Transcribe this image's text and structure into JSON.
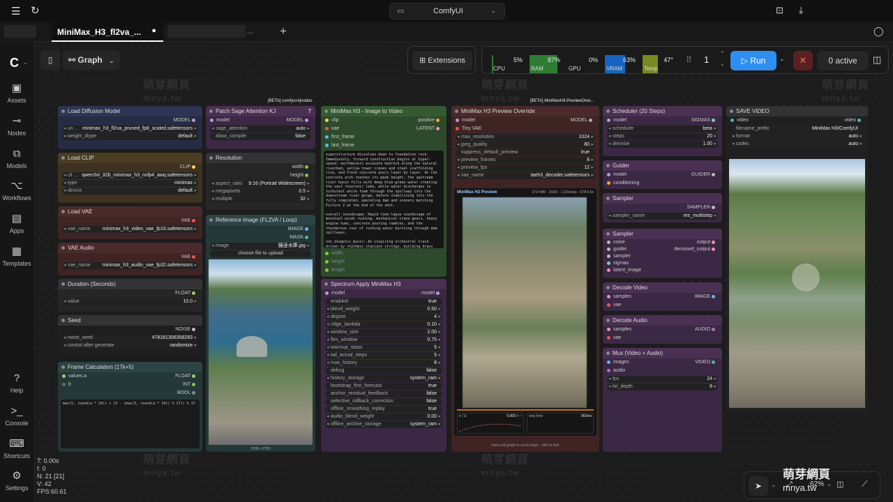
{
  "app": {
    "title": "ComfyUI"
  },
  "tab": {
    "name": "MiniMax_H3_fl2va_..."
  },
  "sidebar": {
    "items": [
      {
        "label": "Assets"
      },
      {
        "label": "Nodes"
      },
      {
        "label": "Models"
      },
      {
        "label": "Workflows"
      },
      {
        "label": "Apps"
      },
      {
        "label": "Templates"
      }
    ],
    "bottom": [
      {
        "label": "Help"
      },
      {
        "label": "Console"
      },
      {
        "label": "Shortcuts"
      },
      {
        "label": "Settings"
      }
    ]
  },
  "toolbar": {
    "graph_label": "Graph",
    "extensions_label": "Extensions",
    "run_label": "Run",
    "queue_count": "1",
    "active_label": "0 active"
  },
  "monitor": {
    "cpu": {
      "label": "CPU",
      "value": "5%",
      "level": 0.05,
      "color": "#2e7d32"
    },
    "ram": {
      "label": "RAM",
      "value": "87%",
      "level": 0.87,
      "color": "#2e7d32"
    },
    "gpu": {
      "label": "GPU",
      "value": "0%",
      "level": 0.0,
      "color": "#2e7d32"
    },
    "vram": {
      "label": "VRAM",
      "value": "63%",
      "level": 0.63,
      "color": "#1565c0"
    },
    "temp": {
      "label": "Temp",
      "value": "47°",
      "level": 0.47,
      "color": "#7a8a1e"
    }
  },
  "badges": {
    "kjnodes": "[BETA] comfyui-kjnodes",
    "preview": "[BETA] MiniMaxH3-PreviewOver..."
  },
  "nodes": {
    "load_diffusion": {
      "title": "Load Diffusion Model",
      "out": "MODEL",
      "unet_label": "un ...",
      "unet_value": "minimax_h3_fl2va_pruned_fp8_scaled.safetensors",
      "wd_label": "weight_dtype",
      "wd_value": "default"
    },
    "patch_sage": {
      "title": "Patch Sage Attention KJ",
      "in": "model",
      "out": "MODEL",
      "sage_label": "sage_attention",
      "sage_value": "auto",
      "compile_label": "allow_compile",
      "compile_value": "false",
      "badge": "?"
    },
    "load_clip": {
      "title": "Load CLIP",
      "out": "CLIP",
      "clip_label": "cli ...",
      "clip_value": "qwen3vl_32b_minimax_h3_nvfp4_awq.safetensors",
      "type_label": "type",
      "type_value": "minimax",
      "device_label": "device",
      "device_value": "default"
    },
    "resolution": {
      "title": "Resolution",
      "out_w": "width",
      "out_h": "height",
      "ar_label": "aspect_ratio",
      "ar_value": "9:16 (Portrait Widescreen)",
      "mp_label": "megapixels",
      "mp_value": "0.5",
      "mult_label": "multiple",
      "mult_value": "32"
    },
    "load_vae": {
      "title": "Load VAE",
      "out": "VAE",
      "vae_label": "vae_name",
      "vae_value": "minimax_h3_video_vae_fp16.safetensors"
    },
    "ref_image": {
      "title": "Reference Image (FL2VA / Loop)",
      "out_img": "IMAGE",
      "out_mask": "MASK",
      "img_label": "image",
      "img_value": "鐘逹水庫.jpg",
      "upload": "choose file to upload",
      "size": "1536 × 2752"
    },
    "vae_audio": {
      "title": "VAE Audio",
      "out": "VAE",
      "vae_label": "vae_name",
      "vae_value": "minimax_h3_audio_vae_fp32.safetensors"
    },
    "duration": {
      "title": "Duration (Seconds)",
      "out": "FLOAT",
      "label": "value",
      "value": "10.0"
    },
    "seed": {
      "title": "Seed",
      "out": "NOISE",
      "seed_label": "noise_seed",
      "seed_value": "478181306358283",
      "ctrl_label": "control after generate",
      "ctrl_value": "randomize"
    },
    "frame_calc": {
      "title": "Frame Calculation (17k+5)",
      "in_a": "values.a",
      "in_b": "b",
      "out_f": "FLOAT",
      "out_i": "INT",
      "out_b": "BOOL",
      "expr": "max(5, round(a * 24)) + (5 - (max(5, round(a * 24)) % 17)) % 17"
    },
    "i2v": {
      "title": "MiniMax H3 - Image to Video",
      "in_clip": "clip",
      "in_vae": "vae",
      "in_ff": "first_frame",
      "in_lf": "last_frame",
      "out_pos": "positive",
      "out_lat": "LATENT",
      "prompt": "superstructure dissolves down to foundation rock. Immediately, forward construction begins at hyper-speed: earthmovers excavate bedrock along the natural riverbed, yellow tower cranes and steel scaffolding rise, and fresh concrete pours layer by layer. As the concrete arch reaches its peak height, the upstream river basin fills with deep blue-green water creating the vast reservoir lake, while water discharges in turbulent white foam through the spillway into the downstream river gorge, before stabilizing into the fully completed, operating dam and scenery matching Picture 2 at the end of the shot.\n\noverall_soundscape: Rapid time-lapse soundscape of mountain winds rushing, mechanical crane gears, heavy engine hums, concrete pouring rumbles, and the thunderous roar of rushing water bursting through dam spillways.\n\nnon_diegetic_music: An inspiring orchestral track driven by rhythmic staccato strings, building brass harmonies, and steady cinematic percussion, concluding on a bright, sustained chord.",
      "w_width": "width",
      "w_height": "height",
      "w_length": "length"
    },
    "spectrum": {
      "title": "Spectrum Apply MiniMax H3",
      "in": "model",
      "out": "model",
      "rows": [
        {
          "label": "enabled",
          "value": "true",
          "toggle": true
        },
        {
          "label": "blend_weight",
          "value": "0.50"
        },
        {
          "label": "degree",
          "value": "4"
        },
        {
          "label": "ridge_lambda",
          "value": "0.10"
        },
        {
          "label": "window_size",
          "value": "2.00"
        },
        {
          "label": "flex_window",
          "value": "0.75"
        },
        {
          "label": "warmup_steps",
          "value": "5"
        },
        {
          "label": "tail_actual_steps",
          "value": "5"
        },
        {
          "label": "max_history",
          "value": "8"
        },
        {
          "label": "debug",
          "value": "false",
          "toggle": true
        },
        {
          "label": "history_storage",
          "value": "system_ram"
        },
        {
          "label": "bootstrap_first_forecast",
          "value": "true",
          "toggle": true
        },
        {
          "label": "anchor_residual_feedback",
          "value": "false",
          "toggle": true
        },
        {
          "label": "selective_rollback_correction",
          "value": "false",
          "toggle": true
        },
        {
          "label": "offline_smoothing_replay",
          "value": "true",
          "toggle": true
        },
        {
          "label": "audio_blend_weight",
          "value": "0.00"
        },
        {
          "label": "offline_archive_storage",
          "value": "system_ram"
        }
      ]
    },
    "preview": {
      "title": "MiniMax H3 Preview Override",
      "in_model": "model",
      "in_vae": "Tiny VAE",
      "out": "MODEL",
      "rows": [
        {
          "label": "max_resolution",
          "value": "1024"
        },
        {
          "label": "jpeg_quality",
          "value": "80"
        },
        {
          "label": "suppress_default_preview",
          "value": "true",
          "toggle": true
        },
        {
          "label": "preview_frames",
          "value": "8"
        },
        {
          "label": "preview_fps",
          "value": "12"
        },
        {
          "label": "vae_name",
          "value": "taeh3_decoder.safetensors"
        }
      ],
      "panel_title": "MiniMax H3 Preview",
      "panel_meta": "272×480 · 20/20 · 1.22s/step · ETA 0.0s",
      "graph_left": "σ / Δ",
      "graph_val": "0.000 / —",
      "graph_right": "step time",
      "graph_time": "952ms",
      "hint": "hover ε/Δ graph to scrub steps · click to lock"
    },
    "scheduler": {
      "title": "Scheduler (20 Steps)",
      "in": "model",
      "out": "SIGMAS",
      "sch_label": "scheduler",
      "sch_value": "beta",
      "steps_label": "steps",
      "steps_value": "20",
      "den_label": "denoise",
      "den_value": "1.00"
    },
    "guider": {
      "title": "Guider",
      "in_model": "model",
      "in_cond": "conditioning",
      "out": "GUIDER"
    },
    "sampler": {
      "title": "Sampler",
      "out": "SAMPLER",
      "label": "sampler_name",
      "value": "res_multistep"
    },
    "sampler2": {
      "title": "Sampler",
      "in_noise": "noise",
      "in_guider": "guider",
      "in_sampler": "sampler",
      "in_sigmas": "sigmas",
      "in_latent": "latent_image",
      "out": "output",
      "out2": "denoised_output"
    },
    "decode_video": {
      "title": "Decode Video",
      "in_s": "samples",
      "in_v": "vae",
      "out": "IMAGE"
    },
    "decode_audio": {
      "title": "Decode Audio",
      "in_s": "samples",
      "in_v": "vae",
      "out": "AUDIO"
    },
    "mux": {
      "title": "Mux (Video + Audio)",
      "in_i": "images",
      "in_a": "audio",
      "out": "VIDEO",
      "fps_label": "fps",
      "fps_value": "24",
      "bd_label": "bit_depth",
      "bd_value": "8"
    },
    "save": {
      "title": "SAVE VIDEO",
      "in": "video",
      "out": "video",
      "fp_label": "filename_prefix",
      "fp_value": "MiniMax H3/ComfyUI",
      "fmt_label": "format",
      "fmt_value": "auto",
      "codec_label": "codec",
      "codec_value": "auto"
    }
  },
  "stats": {
    "t": "T: 0.00s",
    "i": "I: 0",
    "n": "N: 21 [21]",
    "v": "V: 42",
    "fps": "FPS:60.61"
  },
  "zoom": "62%",
  "watermark": {
    "main": "萌芽網頁",
    "sub": "mnya.tw"
  }
}
